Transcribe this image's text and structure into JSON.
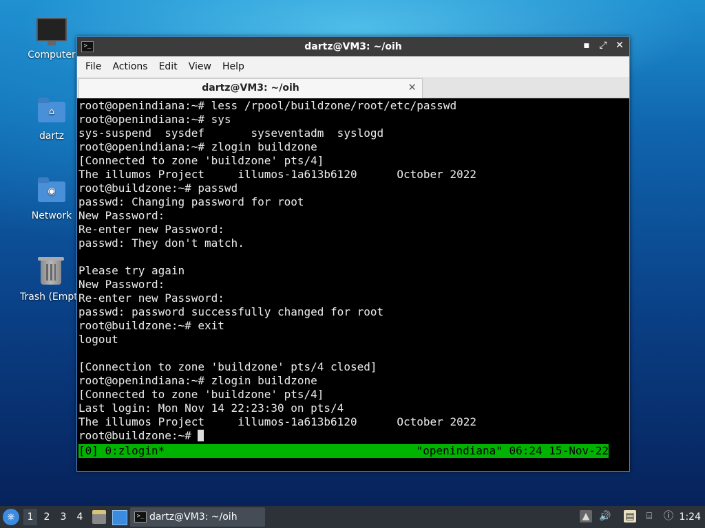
{
  "desktop": {
    "icons": [
      {
        "label": "Computer"
      },
      {
        "label": "dartz"
      },
      {
        "label": "Network"
      },
      {
        "label": "Trash (Empty)"
      }
    ]
  },
  "window": {
    "title": "dartz@VM3: ~/oih",
    "controls": {
      "minimize": "▪",
      "maximize": "⤢",
      "close": "✕"
    }
  },
  "menubar": {
    "items": [
      "File",
      "Actions",
      "Edit",
      "View",
      "Help"
    ]
  },
  "tab": {
    "label": "dartz@VM3: ~/oih",
    "close": "✕"
  },
  "terminal": {
    "lines": [
      "root@openindiana:~# less /rpool/buildzone/root/etc/passwd",
      "root@openindiana:~# sys",
      "sys-suspend  sysdef       syseventadm  syslogd",
      "root@openindiana:~# zlogin buildzone",
      "[Connected to zone 'buildzone' pts/4]",
      "The illumos Project     illumos-1a613b6120      October 2022",
      "root@buildzone:~# passwd",
      "passwd: Changing password for root",
      "New Password:",
      "Re-enter new Password:",
      "passwd: They don't match.",
      "",
      "Please try again",
      "New Password:",
      "Re-enter new Password:",
      "passwd: password successfully changed for root",
      "root@buildzone:~# exit",
      "logout",
      "",
      "[Connection to zone 'buildzone' pts/4 closed]",
      "root@openindiana:~# zlogin buildzone",
      "[Connected to zone 'buildzone' pts/4]",
      "Last login: Mon Nov 14 22:23:30 on pts/4",
      "The illumos Project     illumos-1a613b6120      October 2022"
    ],
    "prompt": "root@buildzone:~# ",
    "status_left": "[0] 0:zlogin*",
    "status_right": "\"openindiana\" 06:24 15-Nov-22",
    "status_color": "#00b300"
  },
  "taskbar": {
    "workspaces": [
      "1",
      "2",
      "3",
      "4"
    ],
    "active_workspace": "1",
    "task_label": "dartz@VM3: ~/oih",
    "clock": "1:24",
    "tray_icons": [
      "upload-icon",
      "volume-icon",
      "clipboard-icon",
      "network-icon",
      "notification-icon"
    ]
  }
}
